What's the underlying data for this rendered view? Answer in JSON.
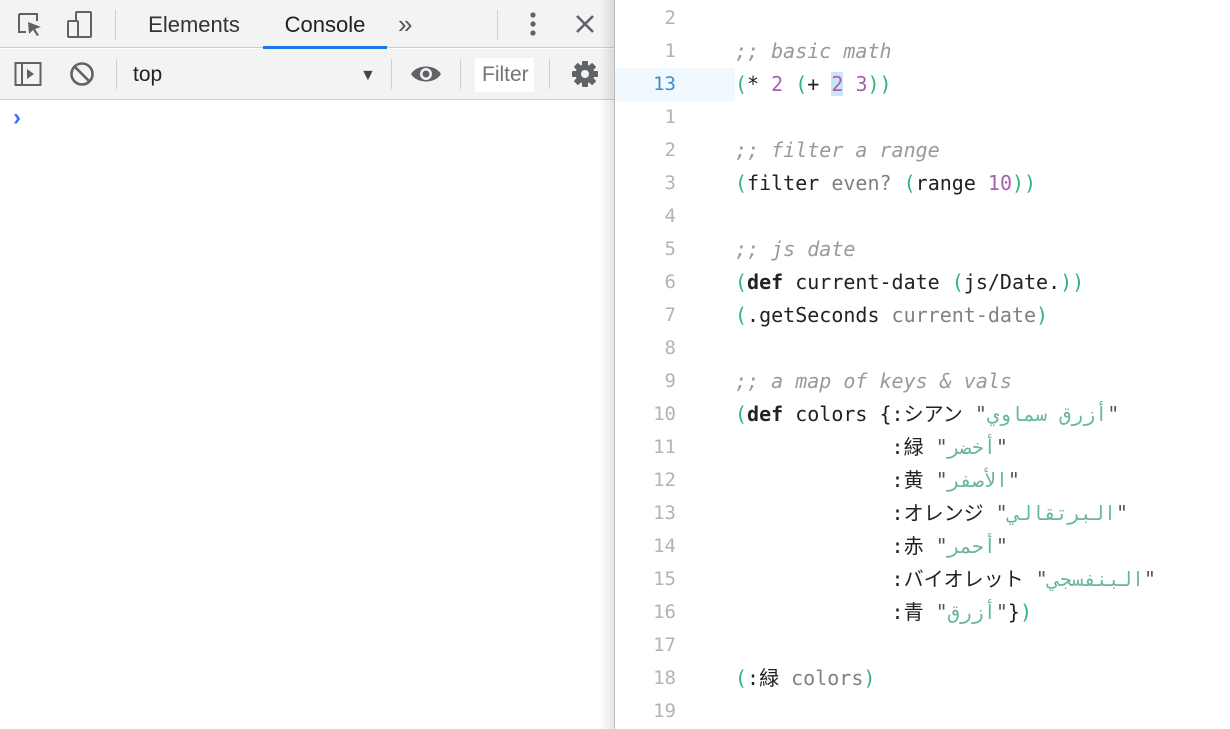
{
  "devtools": {
    "tabs": [
      {
        "label": "Elements",
        "active": false
      },
      {
        "label": "Console",
        "active": true
      }
    ],
    "toolbar_icons": [
      "inspect-element-icon",
      "device-toolbar-icon",
      "more-tabs-icon",
      "kebab-menu-icon",
      "close-icon"
    ],
    "console_bar": {
      "context": "top",
      "filter_placeholder": "Filter",
      "icons": [
        "show-sidebar-icon",
        "clear-console-icon",
        "dropdown-arrow-icon",
        "eye-icon",
        "gear-icon"
      ]
    },
    "prompt_glyph": "›"
  },
  "colors": {
    "accent": "#1a73e8",
    "prompt": "#3b78e7",
    "paren": "#2fb57c",
    "number": "#a75fb4",
    "string": "#69b89a",
    "comment": "#999999"
  },
  "editor": {
    "lines": [
      {
        "num": "2",
        "tokens": []
      },
      {
        "num": "1",
        "tokens": [
          {
            "t": ";; basic math",
            "c": "cm"
          }
        ]
      },
      {
        "num": "13",
        "active": true,
        "tokens": [
          {
            "t": "(",
            "c": "p"
          },
          {
            "t": "* ",
            "c": ""
          },
          {
            "t": "2",
            "c": "n"
          },
          {
            "t": " ",
            "c": ""
          },
          {
            "t": "(",
            "c": "p"
          },
          {
            "t": "+ ",
            "c": ""
          },
          {
            "t": "2",
            "c": "nb"
          },
          {
            "t": " ",
            "c": ""
          },
          {
            "t": "3",
            "c": "n"
          },
          {
            "t": "))",
            "c": "p"
          }
        ]
      },
      {
        "num": "1",
        "tokens": []
      },
      {
        "num": "2",
        "tokens": [
          {
            "t": ";; filter a range",
            "c": "cm"
          }
        ]
      },
      {
        "num": "3",
        "tokens": [
          {
            "t": "(",
            "c": "p"
          },
          {
            "t": "filter ",
            "c": ""
          },
          {
            "t": "even?",
            "c": "v"
          },
          {
            "t": " ",
            "c": ""
          },
          {
            "t": "(",
            "c": "p"
          },
          {
            "t": "range ",
            "c": ""
          },
          {
            "t": "10",
            "c": "n"
          },
          {
            "t": "))",
            "c": "p"
          }
        ]
      },
      {
        "num": "4",
        "tokens": []
      },
      {
        "num": "5",
        "tokens": [
          {
            "t": ";; js date",
            "c": "cm"
          }
        ]
      },
      {
        "num": "6",
        "tokens": [
          {
            "t": "(",
            "c": "p"
          },
          {
            "t": "def",
            "c": "kw"
          },
          {
            "t": " current-date ",
            "c": ""
          },
          {
            "t": "(",
            "c": "p"
          },
          {
            "t": "js/Date.",
            "c": ""
          },
          {
            "t": "))",
            "c": "p"
          }
        ]
      },
      {
        "num": "7",
        "tokens": [
          {
            "t": "(",
            "c": "p"
          },
          {
            "t": ".getSeconds ",
            "c": ""
          },
          {
            "t": "current-date",
            "c": "v"
          },
          {
            "t": ")",
            "c": "p"
          }
        ]
      },
      {
        "num": "8",
        "tokens": []
      },
      {
        "num": "9",
        "tokens": [
          {
            "t": ";; a map of keys & vals",
            "c": "cm"
          }
        ]
      },
      {
        "num": "10",
        "tokens": [
          {
            "t": "(",
            "c": "p"
          },
          {
            "t": "def",
            "c": "kw"
          },
          {
            "t": " colors {:シアン ",
            "c": ""
          },
          {
            "t": "\"",
            "c": "q"
          },
          {
            "t": "أزرق سماوي",
            "c": "s"
          },
          {
            "t": "\"",
            "c": "q"
          }
        ]
      },
      {
        "num": "11",
        "tokens": [
          {
            "t": "             :緑 ",
            "c": ""
          },
          {
            "t": "\"",
            "c": "q"
          },
          {
            "t": "أخضر",
            "c": "s"
          },
          {
            "t": "\"",
            "c": "q"
          }
        ]
      },
      {
        "num": "12",
        "tokens": [
          {
            "t": "             :黄 ",
            "c": ""
          },
          {
            "t": "\"",
            "c": "q"
          },
          {
            "t": "الأصفر",
            "c": "s"
          },
          {
            "t": "\"",
            "c": "q"
          }
        ]
      },
      {
        "num": "13",
        "tokens": [
          {
            "t": "             :オレンジ ",
            "c": ""
          },
          {
            "t": "\"",
            "c": "q"
          },
          {
            "t": "البرتقالي",
            "c": "s"
          },
          {
            "t": "\"",
            "c": "q"
          }
        ]
      },
      {
        "num": "14",
        "tokens": [
          {
            "t": "             :赤 ",
            "c": ""
          },
          {
            "t": "\"",
            "c": "q"
          },
          {
            "t": "أحمر",
            "c": "s"
          },
          {
            "t": "\"",
            "c": "q"
          }
        ]
      },
      {
        "num": "15",
        "tokens": [
          {
            "t": "             :バイオレット ",
            "c": ""
          },
          {
            "t": "\"",
            "c": "q"
          },
          {
            "t": "البنفسجي",
            "c": "s"
          },
          {
            "t": "\"",
            "c": "q"
          }
        ]
      },
      {
        "num": "16",
        "tokens": [
          {
            "t": "             :青 ",
            "c": ""
          },
          {
            "t": "\"",
            "c": "q"
          },
          {
            "t": "أزرق",
            "c": "s"
          },
          {
            "t": "\"",
            "c": "q"
          },
          {
            "t": "}",
            "c": ""
          },
          {
            "t": ")",
            "c": "p"
          }
        ]
      },
      {
        "num": "17",
        "tokens": []
      },
      {
        "num": "18",
        "tokens": [
          {
            "t": "(",
            "c": "p"
          },
          {
            "t": ":緑 ",
            "c": ""
          },
          {
            "t": "colors",
            "c": "v"
          },
          {
            "t": ")",
            "c": "p"
          }
        ]
      },
      {
        "num": "19",
        "tokens": []
      }
    ]
  }
}
